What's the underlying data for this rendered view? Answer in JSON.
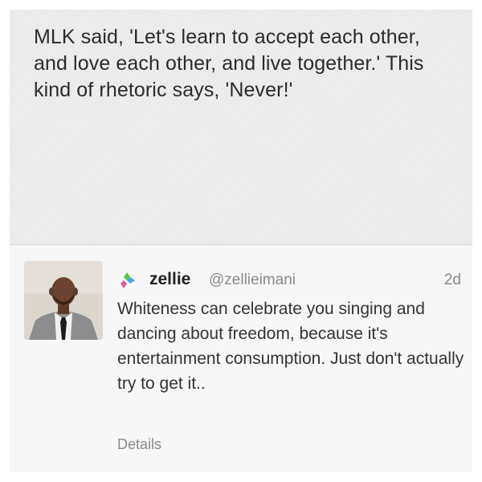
{
  "quote": {
    "text": "MLK said, 'Let's learn to accept each other, and love each other, and live together.' This kind of rhetoric says, 'Never!'"
  },
  "tweet": {
    "app_icon": "multicolor-app-icon",
    "avatar_icon": "user-avatar",
    "display_name": "zellie",
    "handle": "@zellieimani",
    "timestamp": "2d",
    "body": "Whiteness can celebrate you singing and dancing about freedom, because it's entertainment consumption. Just don't actually try to get it..",
    "details_label": "Details"
  },
  "colors": {
    "quote_background": "#ececec",
    "tweet_background": "#f7f7f7",
    "text_primary": "#2b2b2b",
    "text_secondary": "#8a8a8a",
    "icon_green": "#5bbf4a",
    "icon_blue": "#4aa6e0",
    "icon_pink": "#e25aa0"
  }
}
